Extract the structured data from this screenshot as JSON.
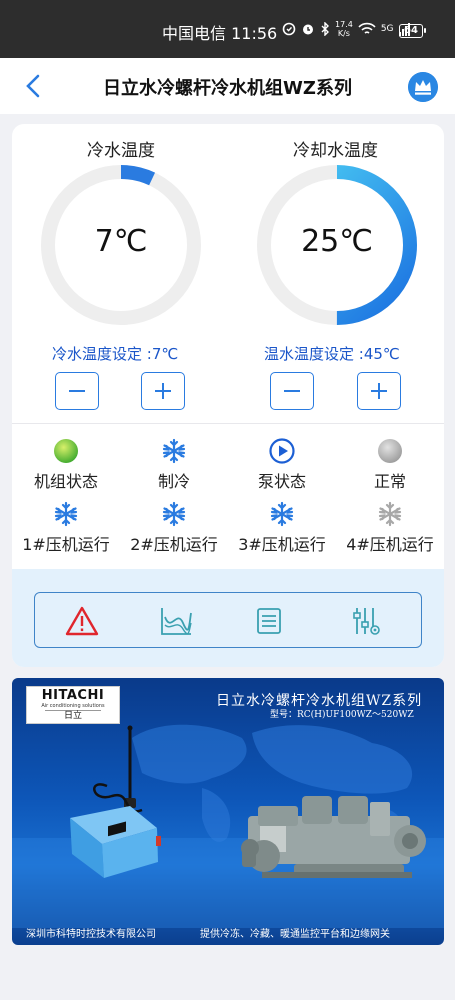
{
  "status_bar": {
    "carrier_time": "中国电信 11:56",
    "speed_value": "17.4",
    "speed_unit": "K/s",
    "signal": "5G",
    "battery": "64"
  },
  "header": {
    "title": "日立水冷螺杆冷水机组WZ系列"
  },
  "chilled_water": {
    "label": "冷水温度",
    "value": "7℃",
    "setpoint": "冷水温度设定 :7℃",
    "level": 0.07
  },
  "cooling_water": {
    "label": "冷却水温度",
    "value": "25℃",
    "setpoint": "温水温度设定 :45℃",
    "level": 0.5
  },
  "status_row1": [
    {
      "label": "机组状态",
      "icon": "green-status-dot"
    },
    {
      "label": "制冷",
      "icon": "snowflake-icon"
    },
    {
      "label": "泵状态",
      "icon": "play-icon"
    },
    {
      "label": "正常",
      "icon": "grey-status-dot"
    }
  ],
  "status_row2": [
    {
      "label": "1#压机运行",
      "icon": "snowflake-icon",
      "active": true
    },
    {
      "label": "2#压机运行",
      "icon": "snowflake-icon",
      "active": true
    },
    {
      "label": "3#压机运行",
      "icon": "snowflake-icon",
      "active": true
    },
    {
      "label": "4#压机运行",
      "icon": "snowflake-icon",
      "active": false
    }
  ],
  "function_bar": [
    "alarm-icon",
    "trend-chart-icon",
    "list-icon",
    "settings-sliders-icon"
  ],
  "banner": {
    "logo_brand": "HITACHI",
    "logo_sub": "Air conditioning solutions",
    "logo_cn": "日立",
    "title": "日立水冷螺杆冷水机组WZ系列",
    "model": "型号：RC(H)UF100WZ～520WZ",
    "footer_left": "深圳市科特时控技术有限公司",
    "footer_right": "提供冷冻、冷藏、暖通监控平台和边缘网关"
  },
  "colors": {
    "accent": "#2a7be0",
    "setpoint_text": "#1b56c9",
    "gauge_track": "#eeeeee",
    "gauge_fill_start": "#1a6fe0",
    "gauge_fill_end": "#4fd3f5",
    "func_bg": "#e3f1fc",
    "alarm": "#e0262d"
  }
}
